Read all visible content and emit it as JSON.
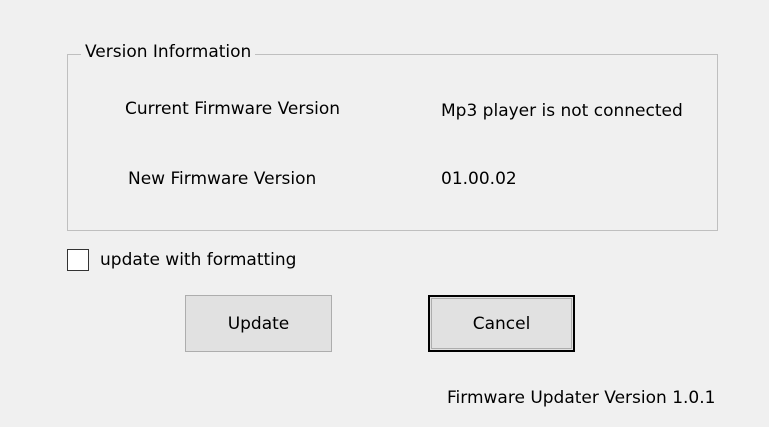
{
  "version_group": {
    "title": "Version Information",
    "current_label": "Current Firmware Version",
    "current_value": "Mp3 player is not connected",
    "new_label": "New Firmware Version",
    "new_value": "01.00.02"
  },
  "options": {
    "format_label": "update with formatting",
    "format_checked": false
  },
  "buttons": {
    "update_label": "Update",
    "cancel_label": "Cancel"
  },
  "footer": {
    "version_text": "Firmware Updater Version 1.0.1"
  },
  "colors": {
    "background": "#f0f0f0",
    "button_face": "#e1e1e1",
    "button_border": "#adadad",
    "default_button_border": "#000000",
    "group_border": "#bfbfbf"
  }
}
